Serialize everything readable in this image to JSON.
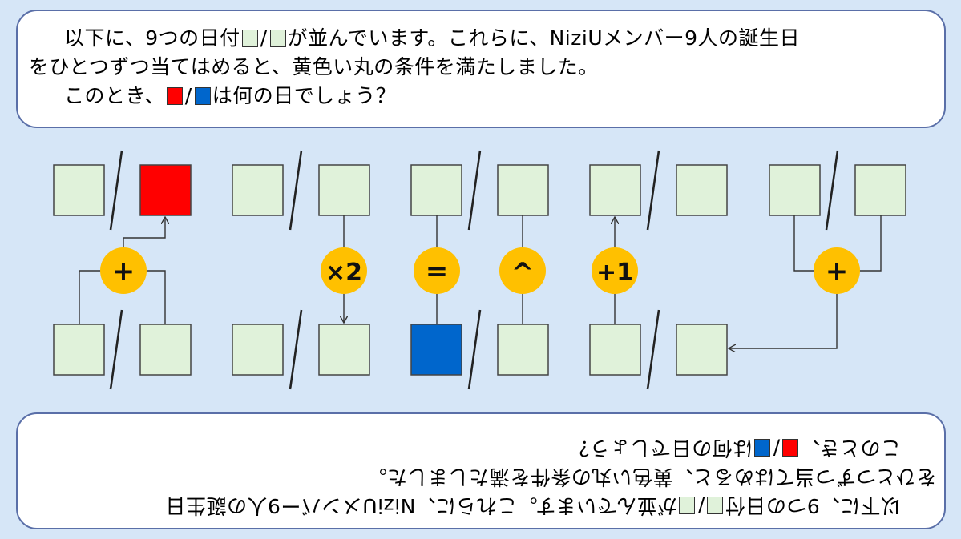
{
  "problem": {
    "line1_a": "以下に、9つの日付",
    "line1_slash": "/",
    "line1_b": "が並んでいます。これらに、NiziUメンバー9人の誕生日",
    "line2": "をひとつずつ当てはめると、黄色い丸の条件を満たしました。",
    "line3_a": "このとき、",
    "line3_slash": "/",
    "line3_b": "は何の日でしょう？"
  },
  "diagram": {
    "operators": [
      "+",
      "×2",
      "=",
      "^",
      "+1",
      "+"
    ],
    "colors": {
      "box_default": "#e0f2da",
      "box_red": "#ff0000",
      "box_blue": "#0066cc",
      "operator_circle": "#ffc000"
    }
  }
}
